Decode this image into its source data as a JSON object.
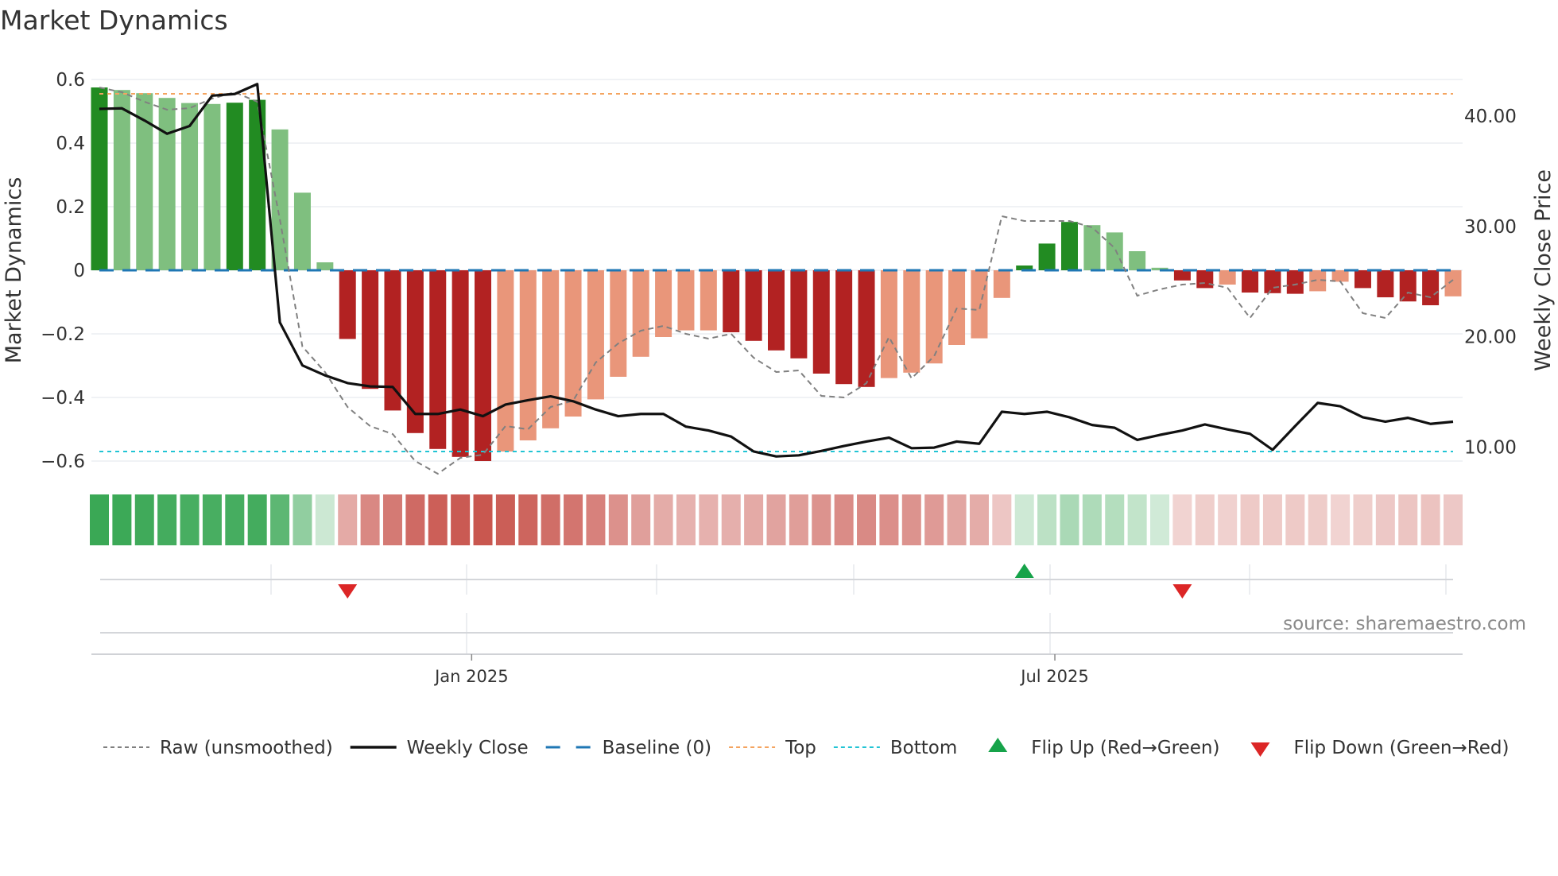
{
  "chart_data": {
    "type": "bar",
    "title": "Market Dynamics",
    "ylabel": "Market Dynamics",
    "y2label": "Weekly Close Price",
    "ylim": [
      -0.65,
      0.64
    ],
    "y2lim": [
      7.5,
      44.7
    ],
    "yticks": [
      0.6,
      0.4,
      0.2,
      0,
      -0.2,
      -0.4,
      -0.6
    ],
    "ytick_labels": [
      "0.6",
      "0.4",
      "0.2",
      "0",
      "−0.2",
      "−0.4",
      "−0.6"
    ],
    "y2ticks": [
      40,
      30,
      20,
      10
    ],
    "y2tick_labels": [
      "40.00",
      "30.00",
      "20.00",
      "10.00"
    ],
    "xtick_labels": [
      {
        "label": "Jan 2025",
        "week_index": 16.5
      },
      {
        "label": "Jul 2025",
        "week_index": 42.35
      }
    ],
    "grid": true,
    "legend_position": "bottom",
    "source": "source: sharemaestro.com",
    "levels": {
      "top": 0.555,
      "bottom": -0.57,
      "baseline": 0
    },
    "bars": {
      "values": [
        0.575,
        0.567,
        0.557,
        0.542,
        0.526,
        0.523,
        0.527,
        0.536,
        0.443,
        0.244,
        0.025,
        -0.216,
        -0.373,
        -0.441,
        -0.512,
        -0.562,
        -0.587,
        -0.6,
        -0.57,
        -0.535,
        -0.497,
        -0.46,
        -0.406,
        -0.335,
        -0.272,
        -0.21,
        -0.189,
        -0.189,
        -0.195,
        -0.222,
        -0.252,
        -0.277,
        -0.325,
        -0.358,
        -0.367,
        -0.339,
        -0.322,
        -0.293,
        -0.235,
        -0.214,
        -0.087,
        0.015,
        0.084,
        0.152,
        0.142,
        0.119,
        0.06,
        0.008,
        -0.032,
        -0.056,
        -0.045,
        -0.07,
        -0.072,
        -0.074,
        -0.066,
        -0.036,
        -0.056,
        -0.085,
        -0.098,
        -0.11,
        -0.082
      ],
      "strong": [
        1,
        0,
        0,
        0,
        0,
        0,
        1,
        1,
        0,
        0,
        0,
        1,
        1,
        1,
        1,
        1,
        1,
        1,
        0,
        0,
        0,
        0,
        0,
        0,
        0,
        0,
        0,
        0,
        1,
        1,
        1,
        1,
        1,
        1,
        1,
        0,
        0,
        0,
        0,
        0,
        0,
        1,
        1,
        1,
        0,
        0,
        0,
        0,
        1,
        1,
        0,
        1,
        1,
        1,
        0,
        0,
        1,
        1,
        1,
        1,
        0
      ]
    },
    "series": [
      {
        "name": "Raw (unsmoothed)",
        "axis": "left",
        "values": [
          0.575,
          0.56,
          0.53,
          0.505,
          0.51,
          0.54,
          0.56,
          0.53,
          0.16,
          -0.24,
          -0.32,
          -0.43,
          -0.49,
          -0.515,
          -0.6,
          -0.64,
          -0.59,
          -0.58,
          -0.49,
          -0.5,
          -0.43,
          -0.41,
          -0.29,
          -0.23,
          -0.19,
          -0.175,
          -0.2,
          -0.215,
          -0.2,
          -0.275,
          -0.32,
          -0.315,
          -0.395,
          -0.4,
          -0.355,
          -0.21,
          -0.34,
          -0.27,
          -0.12,
          -0.125,
          0.17,
          0.155,
          0.155,
          0.155,
          0.135,
          0.07,
          -0.08,
          -0.06,
          -0.045,
          -0.04,
          -0.055,
          -0.15,
          -0.055,
          -0.045,
          -0.03,
          -0.035,
          -0.135,
          -0.15,
          -0.07,
          -0.085,
          -0.03
        ]
      },
      {
        "name": "Weekly Close",
        "axis": "right",
        "values": [
          40.65,
          40.7,
          39.6,
          38.4,
          39.1,
          41.85,
          42.0,
          42.9,
          21.3,
          17.4,
          16.5,
          15.8,
          15.5,
          15.45,
          13.0,
          13.0,
          13.4,
          12.8,
          13.85,
          14.25,
          14.6,
          14.15,
          13.4,
          12.8,
          13.0,
          13.0,
          11.85,
          11.5,
          10.95,
          9.6,
          9.15,
          9.25,
          9.65,
          10.1,
          10.5,
          10.85,
          9.9,
          9.95,
          10.5,
          10.3,
          13.2,
          13.0,
          13.2,
          12.7,
          12.0,
          11.75,
          10.65,
          11.1,
          11.5,
          12.05,
          11.6,
          11.2,
          9.75,
          11.9,
          14.0,
          13.7,
          12.7,
          12.3,
          12.65,
          12.1,
          12.3
        ]
      }
    ],
    "flips": [
      {
        "type": "down",
        "week_index": 11
      },
      {
        "type": "up",
        "week_index": 41
      },
      {
        "type": "down",
        "week_index": 48
      }
    ],
    "legend": [
      {
        "label": "Raw (unsmoothed)",
        "style": "raw"
      },
      {
        "label": "Weekly Close",
        "style": "close"
      },
      {
        "label": "Baseline (0)",
        "style": "baseline"
      },
      {
        "label": "Top",
        "style": "top"
      },
      {
        "label": "Bottom",
        "style": "bottom"
      },
      {
        "label": "Flip Up (Red→Green)",
        "style": "flip-up"
      },
      {
        "label": "Flip Down (Green→Red)",
        "style": "flip-down"
      }
    ],
    "colors": {
      "pos_strong": "#228b22",
      "pos_weak": "#7fbf7f",
      "neg_strong": "#b22222",
      "neg_weak": "#e9967a",
      "raw": "#808080",
      "close": "#111111",
      "baseline": "#1f77b4",
      "top": "#f4a460",
      "bottom": "#22c4d4",
      "flip_up": "#16a34a",
      "flip_down": "#dc2626",
      "grid": "#eceef2"
    }
  }
}
